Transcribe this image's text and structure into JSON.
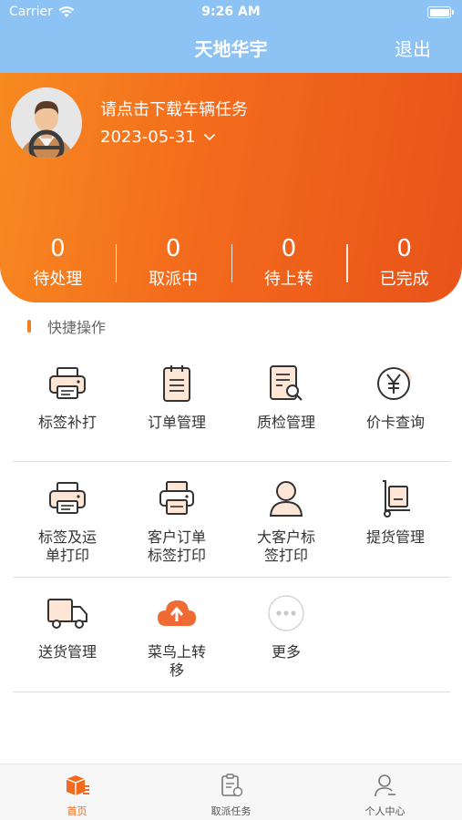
{
  "status_bar": {
    "carrier": "Carrier",
    "time": "9:26 AM"
  },
  "nav": {
    "title": "天地华宇",
    "logout": "退出"
  },
  "hero": {
    "prompt": "请点击下载车辆任务",
    "date": "2023-05-31",
    "stats": [
      {
        "value": "0",
        "label": "待处理"
      },
      {
        "value": "0",
        "label": "取派中"
      },
      {
        "value": "0",
        "label": "待上转"
      },
      {
        "value": "0",
        "label": "已完成"
      }
    ]
  },
  "quick": {
    "title": "快捷操作",
    "items": [
      {
        "label": "标签补打",
        "icon": "printer-icon"
      },
      {
        "label": "订单管理",
        "icon": "clipboard-icon"
      },
      {
        "label": "质检管理",
        "icon": "inspection-doc-icon"
      },
      {
        "label": "价卡查询",
        "icon": "yen-icon"
      },
      {
        "label": "标签及运单打印",
        "icon": "printer-icon"
      },
      {
        "label": "客户订单标签打印",
        "icon": "printer-paper-icon"
      },
      {
        "label": "大客户标签打印",
        "icon": "person-icon"
      },
      {
        "label": "提货管理",
        "icon": "hand-truck-icon"
      },
      {
        "label": "送货管理",
        "icon": "delivery-truck-icon"
      },
      {
        "label": "菜鸟上转移",
        "icon": "cloud-upload-icon"
      },
      {
        "label": "更多",
        "icon": "more-icon"
      }
    ]
  },
  "tabs": [
    {
      "label": "首页",
      "icon": "home-box-icon",
      "active": true
    },
    {
      "label": "取派任务",
      "icon": "task-clipboard-icon",
      "active": false
    },
    {
      "label": "个人中心",
      "icon": "user-icon",
      "active": false
    }
  ],
  "colors": {
    "nav": "#8cc2f4",
    "accent": "#f36a1c",
    "accent_light": "#f78a21"
  }
}
